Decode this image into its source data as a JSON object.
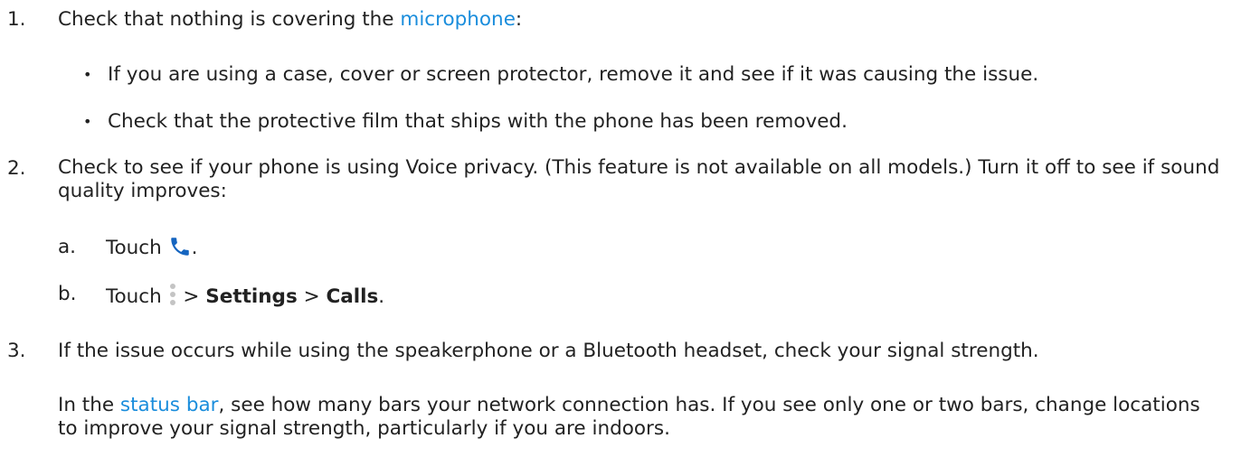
{
  "steps": [
    {
      "number": "1.",
      "text_before": "Check that nothing is covering the ",
      "link": "microphone",
      "text_after": ":",
      "bullets": [
        "If you are using a case, cover or screen protector, remove it and see if it was causing the issue.",
        "Check that the protective film that ships with the phone has been removed."
      ],
      "bullet_glyph": "•"
    },
    {
      "number": "2.",
      "text": "Check to see if your phone is using Voice privacy. (This feature is not available on all models.) Turn it off to see if sound quality improves:",
      "substeps": [
        {
          "letter": "a.",
          "prefix": "Touch",
          "icon": "phone-icon",
          "suffix": "."
        },
        {
          "letter": "b.",
          "prefix": "Touch",
          "icon": "more-vertical-icon",
          "sep1": " > ",
          "bold1": "Settings",
          "sep2": " > ",
          "bold2": "Calls",
          "suffix": "."
        }
      ]
    },
    {
      "number": "3.",
      "text": "If the issue occurs while using the speakerphone or a Bluetooth headset, check your signal strength.",
      "para_before": "In the ",
      "para_link": "status bar",
      "para_after": ", see how many bars your network connection has. If you see only one or two bars, change locations to improve your signal strength, particularly if you are indoors."
    }
  ],
  "colors": {
    "link": "#1a8ddc",
    "text": "#222222",
    "phone_icon": "#1565c0",
    "more_icon": "#c4c4c4"
  }
}
